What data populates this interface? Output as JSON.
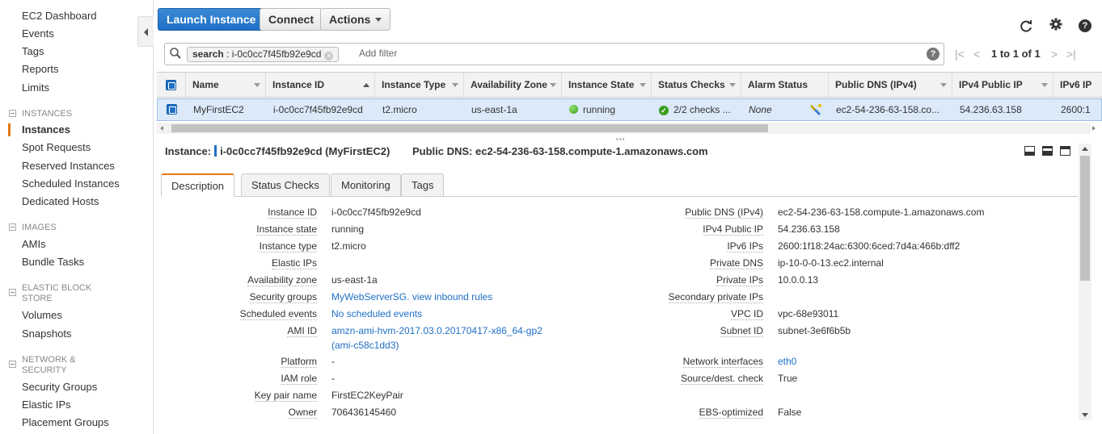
{
  "sidebar": {
    "top_items": [
      {
        "label": "EC2 Dashboard"
      },
      {
        "label": "Events"
      },
      {
        "label": "Tags"
      },
      {
        "label": "Reports"
      },
      {
        "label": "Limits"
      }
    ],
    "sections": [
      {
        "header": "INSTANCES",
        "items": [
          "Instances",
          "Spot Requests",
          "Reserved Instances",
          "Scheduled Instances",
          "Dedicated Hosts"
        ]
      },
      {
        "header": "IMAGES",
        "items": [
          "AMIs",
          "Bundle Tasks"
        ]
      },
      {
        "header_line1": "ELASTIC BLOCK",
        "header_line2": "STORE",
        "items": [
          "Volumes",
          "Snapshots"
        ]
      },
      {
        "header_line1": "NETWORK &",
        "header_line2": "SECURITY",
        "items": [
          "Security Groups",
          "Elastic IPs",
          "Placement Groups"
        ]
      }
    ],
    "active_item": "Instances",
    "accent_color": "#e47911"
  },
  "toolbar": {
    "launch_label": "Launch Instance",
    "connect_label": "Connect",
    "actions_label": "Actions"
  },
  "top_icons": [
    "refresh-icon",
    "gear-icon",
    "help-icon"
  ],
  "filter": {
    "token_key": "search",
    "token_value": "i-0c0cc7f45fb92e9cd",
    "placeholder": "Add filter"
  },
  "pager": {
    "text": "1 to 1 of 1"
  },
  "table": {
    "columns": [
      "Name",
      "Instance ID",
      "Instance Type",
      "Availability Zone",
      "Instance State",
      "Status Checks",
      "Alarm Status",
      "Public DNS (IPv4)",
      "IPv4 Public IP",
      "IPv6 IP"
    ],
    "row": {
      "name": "MyFirstEC2",
      "instance_id": "i-0c0cc7f45fb92e9cd",
      "instance_type": "t2.micro",
      "availability_zone": "us-east-1a",
      "instance_state": "running",
      "status_checks": "2/2 checks ...",
      "alarm_status": "None",
      "public_dns": "ec2-54-236-63-158.co...",
      "ipv4_public_ip": "54.236.63.158",
      "ipv6_ip": "2600:1"
    }
  },
  "detail": {
    "instance_label": "Instance:",
    "instance_value": "i-0c0cc7f45fb92e9cd (MyFirstEC2)",
    "dns_label": "Public DNS:",
    "dns_value": "ec2-54-236-63-158.compute-1.amazonaws.com",
    "tabs": [
      "Description",
      "Status Checks",
      "Monitoring",
      "Tags"
    ],
    "active_tab": "Description",
    "left": [
      {
        "label": "Instance ID",
        "value": "i-0c0cc7f45fb92e9cd"
      },
      {
        "label": "Instance state",
        "value": "running"
      },
      {
        "label": "Instance type",
        "value": "t2.micro"
      },
      {
        "label": "Elastic IPs",
        "value": ""
      },
      {
        "label": "Availability zone",
        "value": "us-east-1a"
      },
      {
        "label": "Security groups",
        "value": "MyWebServerSG. view inbound rules"
      },
      {
        "label": "Scheduled events",
        "value": "No scheduled events"
      },
      {
        "label": "AMI ID",
        "value": "amzn-ami-hvm-2017.03.0.20170417-x86_64-gp2",
        "value2": "(ami-c58c1dd3)"
      },
      {
        "label": "Platform",
        "value": "-"
      },
      {
        "label": "IAM role",
        "value": "-"
      },
      {
        "label": "Key pair name",
        "value": "FirstEC2KeyPair"
      },
      {
        "label": "Owner",
        "value": "706436145460"
      }
    ],
    "right": [
      {
        "label": "Public DNS (IPv4)",
        "value": "ec2-54-236-63-158.compute-1.amazonaws.com"
      },
      {
        "label": "IPv4 Public IP",
        "value": "54.236.63.158"
      },
      {
        "label": "IPv6 IPs",
        "value": "2600:1f18:24ac:6300:6ced:7d4a:466b:dff2"
      },
      {
        "label": "Private DNS",
        "value": "ip-10-0-0-13.ec2.internal"
      },
      {
        "label": "Private IPs",
        "value": "10.0.0.13"
      },
      {
        "label": "Secondary private IPs",
        "value": ""
      },
      {
        "label": "VPC ID",
        "value": "vpc-68e93011"
      },
      {
        "label": "Subnet ID",
        "value": "subnet-3e6f6b5b"
      },
      {
        "label": "Network interfaces",
        "value": "eth0"
      },
      {
        "label": "Source/dest. check",
        "value": "True"
      },
      {
        "label": "EBS-optimized",
        "value": "False"
      }
    ]
  },
  "colors": {
    "primary": "#1f6fc5",
    "link": "#1f6fc5",
    "running": "#3a9d1e",
    "selected_row": "#dbe9f8"
  }
}
